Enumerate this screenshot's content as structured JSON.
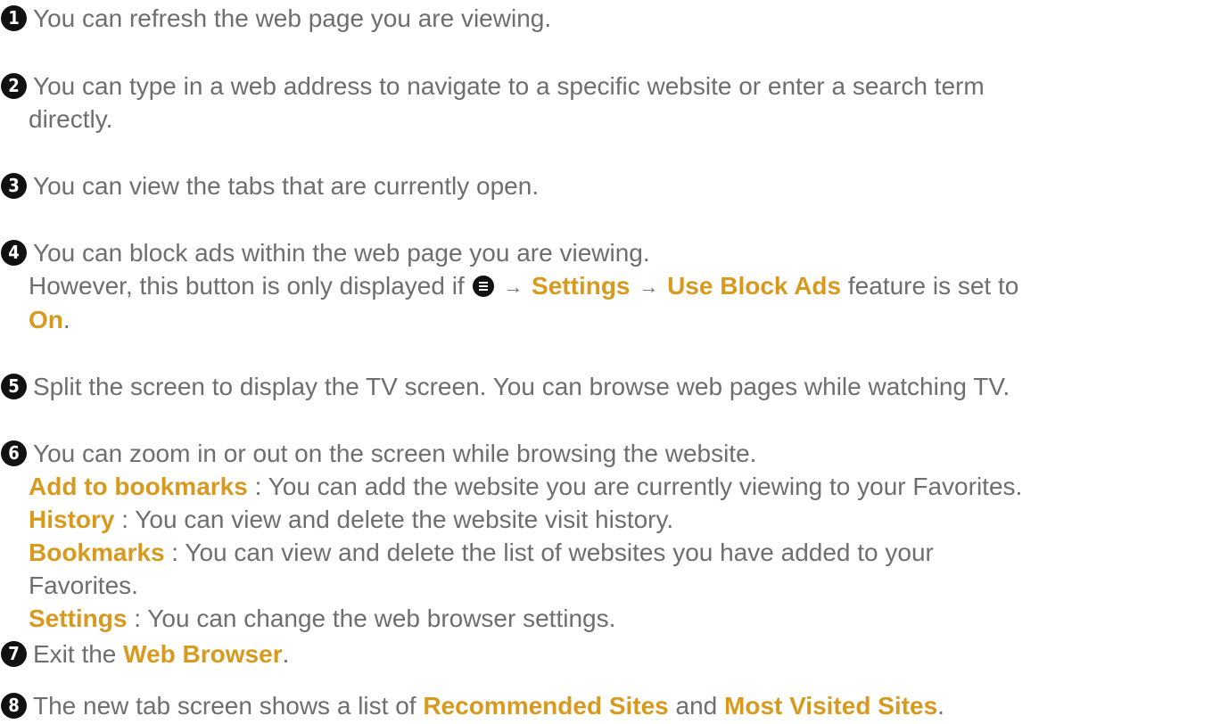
{
  "items": [
    {
      "number": "1",
      "text": "You can refresh the web page you are viewing."
    },
    {
      "number": "2",
      "line1": "You can type in a web address to navigate to a specific website or enter a search term",
      "line2": "directly."
    },
    {
      "number": "3",
      "text": "You can view the tabs that are currently open."
    },
    {
      "number": "4",
      "line1": "You can block ads within the web page you are viewing.",
      "line2_prefix": "However, this button is only displayed if",
      "arrow": "→",
      "menu_path_1": "Settings",
      "menu_path_2": "Use Block Ads",
      "line2_suffix": "feature is set to",
      "value": "On",
      "period": "."
    },
    {
      "number": "5",
      "text": "Split the screen to display the TV screen. You can browse web pages while watching TV."
    },
    {
      "number": "6",
      "line1": "You can zoom in or out on the screen while browsing the website.",
      "options": [
        {
          "label": "Add to bookmarks",
          "desc": " : You can add the website you are currently viewing to your Favorites."
        },
        {
          "label": "History",
          "desc": " : You can view and delete the website visit history."
        },
        {
          "label": "Bookmarks",
          "desc": " : You can view and delete the list of websites you have added to your",
          "desc_cont": "Favorites."
        },
        {
          "label": "Settings",
          "desc": " : You can change the web browser settings."
        }
      ]
    },
    {
      "number": "7",
      "prefix": "Exit the ",
      "highlight": "Web Browser",
      "suffix": "."
    },
    {
      "number": "8",
      "prefix": "The new tab screen shows a list of ",
      "highlight1": "Recommended Sites",
      "middle": " and ",
      "highlight2": "Most Visited Sites",
      "suffix": "."
    }
  ],
  "icons": {
    "menu": "menu-list-icon",
    "arrow": "arrow-right-icon"
  },
  "colors": {
    "text": "#6e6e6e",
    "highlight": "#d79a1f",
    "number_badge": "#111111"
  }
}
